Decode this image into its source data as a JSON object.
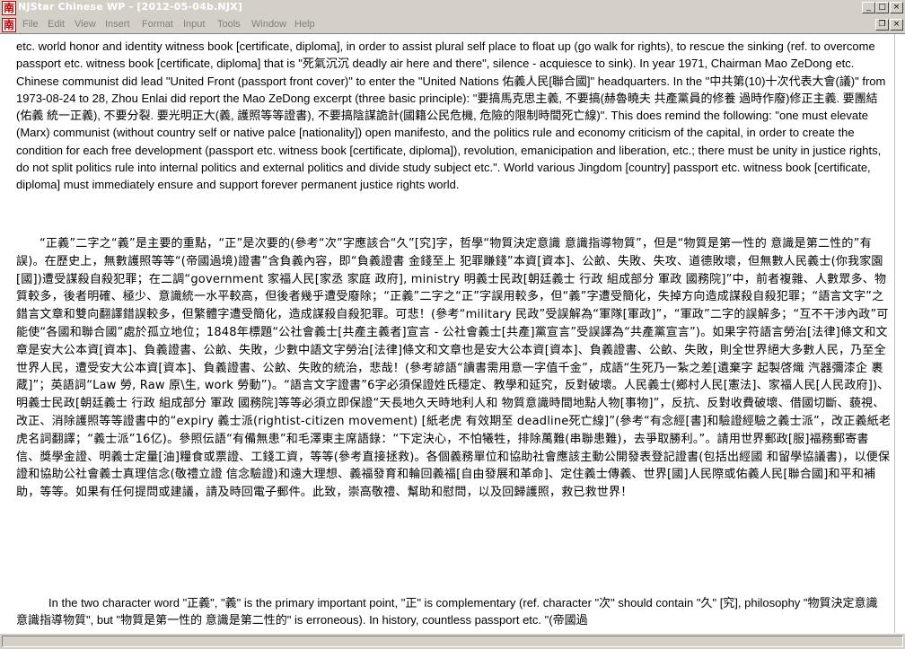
{
  "window": {
    "title": "NJStar Chinese WP - [2012-05-04b.NJX]",
    "icon_glyph": "南",
    "minimize_glyph": "_",
    "maximize_glyph": "□",
    "close_glyph": "×",
    "restore_glyph": "❐",
    "colors": {
      "chrome": "#d4d0c8",
      "icon_red": "#c00000"
    }
  },
  "menu": {
    "items": [
      {
        "label": "File"
      },
      {
        "label": "Edit"
      },
      {
        "label": "View"
      },
      {
        "label": "Insert"
      },
      {
        "label": "Format"
      },
      {
        "label": "Input"
      },
      {
        "label": "Tools"
      },
      {
        "label": "Window"
      },
      {
        "label": "Help"
      }
    ]
  },
  "document": {
    "paragraph1": "etc. world honor and identity witness book [certificate, diploma], in order to assist plural self place to float up (go walk for rights), to rescue the sinking (ref. to overcome passport etc. witness book [certificate, diploma] that is \"死氣沉沉 deadly air here and there\", silence - acquiesce to sink).  In year 1971, Chairman Mao ZeDong etc. Chinese communist did lead \"United Front (passport front cover)\" to enter the \"United Nations 佑義人民[聯合國]\" headquarters.  In the \"中共第(10)十次代表大會(議)\" from 1973-08-24 to 28, Zhou Enlai did report the Mao ZeDong excerpt (three basic principle): \"要搞馬克思主義, 不要搞(赫魯曉夫 共產黨員的修養 過時作廢)修正主義. 要團結(佑義 統一正義), 不要分裂. 要光明正大(義, 護照等等證書), 不要搞陰謀詭計(國籍公民危機, 危險的限制時間死亡線)\".  This does remind the following: \"one must elevate (Marx) communist (without country self or native palce [nationality]) open manifesto, and the politics rule and economy criticism of the capital, in order to create the condition for each free development (passport etc. witness book [certificate, diploma]), revolution, emanicipation and liberation, etc.; there must be unity in justice rights, do not split politics rule into internal politics and external politics and divide study subject etc.\".  World various Jingdom [country] passport etc. witness book [certificate, diploma] must immediately ensure and support forever permanent justice rights world.",
    "paragraph2": "“正義”二字之“義”是主要的重點，“正”是次要的(參考“次”字應該合“久”[究]字，哲學“物質決定意識 意識指導物質”，但是“物質是第一性的 意識是第二性的”有誤)。在歷史上，無數護照等等“(帝國過境)證書”含負義內容，即“負義證書 金錢至上 犯罪賺錢”本資[資本]、公畝、失敗、失攻、道德敗壞，但無數人民義士(你我家園[國])遭受謀殺自殺犯罪；在二調“government 家福人民[家丞 家庭 政府], ministry 明義士民政[朝廷義士 行政 組成部分 軍政 國務院]”中，前者複雜、人數眾多、物質較多，後者明確、極少、意識統一水平較高，但後者幾乎遭受廢除；“正義”二字之“正”字誤用較多，但“義”字遭受簡化，失掉方向造成謀殺自殺犯罪；“語言文字”之錯言文章和雙向翻譯錯誤較多，但繁體字遭受簡化，造成謀殺自殺犯罪。可悲！(參考“military 民政”受誤解為“軍隊[軍政]”，“軍政”二字的誤解多；“互不干涉內政”可能使“各國和聯合國”處於孤立地位；1848年標題“公社會義士[共產主義者]宣言 - 公社會義士[共產]黨宣言”受誤譯為“共產黨宣言”)。如果字符語言勞治[法律]條文和文章是安大公本資[資本]、負義證書、公畝、失敗，少數中語文字勞治[法律]條文和文章也是安大公本資[資本]、負義證書、公畝、失敗，則全世界絕大多數人民，乃至全世界人民，遭受安大公本資[資本]、負義證書、公畝、失敗的統治，悲哉！(參考諺語“讀書需用意一字值千金”，成語“生死乃一紮之差[遺棄字 起製啓熾 汽器彌漆企 裹蔵]”；英語詞“Law 勞, Raw 原\\生, work 勞動”)。“語言文字證書”6字必須保證姓氏穩定、教學和延究，反對破壞。人民義士(鄉村人民[憲法]、家福人民[人民政府])、明義士民政[朝廷義士 行政 組成部分 軍政 國務院]等等必須立即保證“天長地久天時地利人和 物質意識時間地點人物[事物]”，反抗、反對收費破壞、借國切斷、藐視、改正、消除護照等等證書中的“expiry 義士派(rightist-citizen movement) [紙老虎 有效期至 deadline死亡線]”(參考“有念經[書]和驗證經驗之義士派”，改正義紙老虎名詞翻譯；“義士派”16亿)。參照伝語“有備無患”和毛澤東主席語錄：“下定決心，不怕犧牲，排除萬難(串聯患難)，去爭取勝利。”。請用世界郵政[服]福務郵寄書信、獎學金證、明義士定量[油]糧食或票證、工錢工資，等等(參考直接拯救)。各個義務單位和協助社會應該主動公開發表登記證書(包括出經國 和留學協議書)，以便保證和協助公社會義士真理信念(敬禮立證 信念驗證)和遠大理想、義福發育和輪回義福[自由發展和革命]、定住義士傳義、世界[國]人民際或佑義人民[聯合國]和平和補助，等等。如果有任何提問或建議，請及時回電子郵件。此致，崇高敬禮、幫助和慰問，以及回歸護照，救已救世界！",
    "paragraph3": "In the two character word \"正義\", \"義\" is the primary important point, \"正\" is complementary (ref. character \"次\" should contain \"久\" [究], philosophy \"物質決定意識 意識指導物質\", but \"物質是第一性的 意識是第二性的\" is erroneous).  In history, countless passport etc. \"(帝國過"
  }
}
